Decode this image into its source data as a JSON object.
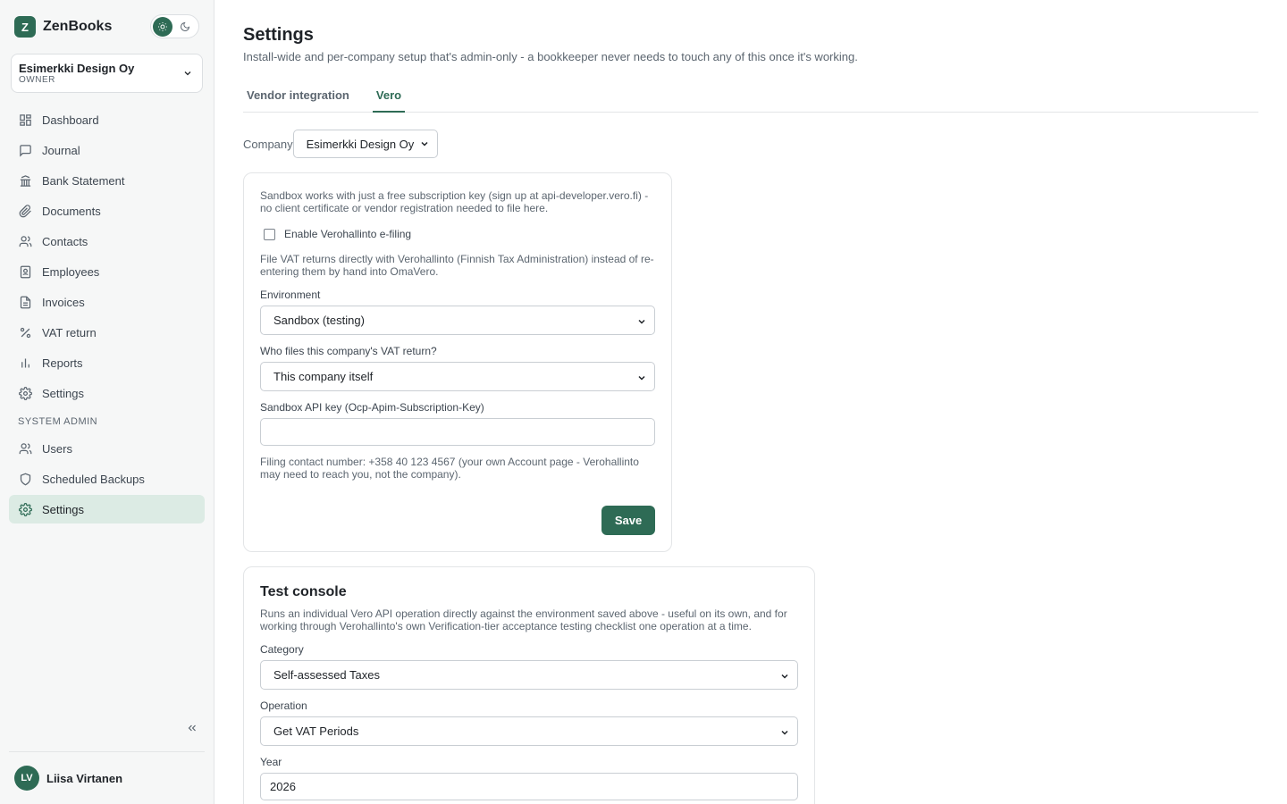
{
  "app": {
    "name": "ZenBooks",
    "logo_letter": "Z"
  },
  "company_switcher": {
    "name": "Esimerkki Design Oy",
    "role": "OWNER"
  },
  "sidebar": {
    "items": [
      {
        "label": "Dashboard",
        "icon": "grid-icon"
      },
      {
        "label": "Journal",
        "icon": "chat-icon"
      },
      {
        "label": "Bank Statement",
        "icon": "bank-icon"
      },
      {
        "label": "Documents",
        "icon": "paperclip-icon"
      },
      {
        "label": "Contacts",
        "icon": "users-icon"
      },
      {
        "label": "Employees",
        "icon": "id-card-icon"
      },
      {
        "label": "Invoices",
        "icon": "file-icon"
      },
      {
        "label": "VAT return",
        "icon": "percent-icon"
      },
      {
        "label": "Reports",
        "icon": "bar-chart-icon"
      },
      {
        "label": "Settings",
        "icon": "gear-icon"
      }
    ],
    "admin_section_label": "SYSTEM ADMIN",
    "admin_items": [
      {
        "label": "Users",
        "icon": "users-icon"
      },
      {
        "label": "Scheduled Backups",
        "icon": "shield-icon"
      },
      {
        "label": "Settings",
        "icon": "gear-icon",
        "active": true
      }
    ]
  },
  "user": {
    "initials": "LV",
    "name": "Liisa Virtanen"
  },
  "page": {
    "title": "Settings",
    "subtitle": "Install-wide and per-company setup that's admin-only - a bookkeeper never needs to touch any of this once it's working."
  },
  "tabs": [
    {
      "label": "Vendor integration",
      "active": false
    },
    {
      "label": "Vero",
      "active": true
    }
  ],
  "company_select": {
    "label": "Company",
    "value": "Esimerkki Design Oy"
  },
  "vero_card": {
    "intro": "Sandbox works with just a free subscription key (sign up at api-developer.vero.fi) - no client certificate or vendor registration needed to file here.",
    "enable_label": "Enable Verohallinto e-filing",
    "enable_description": "File VAT returns directly with Verohallinto (Finnish Tax Administration) instead of re-entering them by hand into OmaVero.",
    "environment_label": "Environment",
    "environment_value": "Sandbox (testing)",
    "filer_label": "Who files this company's VAT return?",
    "filer_value": "This company itself",
    "api_key_label": "Sandbox API key (Ocp-Apim-Subscription-Key)",
    "api_key_value": "",
    "contact_note": "Filing contact number: +358 40 123 4567 (your own Account page - Verohallinto may need to reach you, not the company).",
    "save_label": "Save"
  },
  "test_console": {
    "title": "Test console",
    "description": "Runs an individual Vero API operation directly against the environment saved above - useful on its own, and for working through Verohallinto's own Verification-tier acceptance testing checklist one operation at a time.",
    "category_label": "Category",
    "category_value": "Self-assessed Taxes",
    "operation_label": "Operation",
    "operation_value": "Get VAT Periods",
    "year_label": "Year",
    "year_value": "2026"
  },
  "colors": {
    "accent": "#2e6b55",
    "active_nav_bg": "#dcebe4",
    "sidebar_bg": "#f6f7f7"
  }
}
